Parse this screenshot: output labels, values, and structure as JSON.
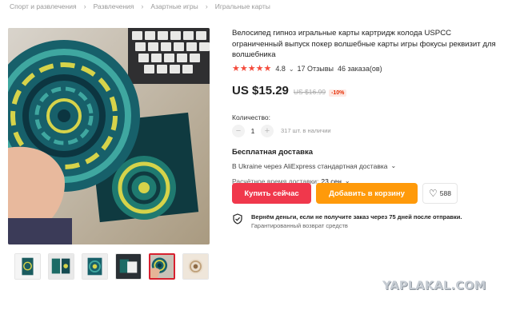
{
  "breadcrumb": [
    "Спорт и развлечения",
    "Развлечения",
    "Азартные игры",
    "Игральные карты"
  ],
  "breadcrumb_separator": "›",
  "product": {
    "title": "Велосипед гипноз игральные карты картридж колода USPCC ограниченный выпуск покер волшебные карты игры фокусы реквизит для волшебника",
    "rating": "4.8",
    "stars": "★★★★★",
    "reviews": "17 Отзывы",
    "orders": "46 заказа(ов)",
    "price": "US $15.29",
    "old_price": "US $16.99",
    "discount": "-10%"
  },
  "quantity": {
    "label": "Количество:",
    "minus": "−",
    "value": "1",
    "plus": "+",
    "stock": "317 шт. в наличии"
  },
  "shipping": {
    "title": "Бесплатная доставка",
    "method": "В Ukraine через AliExpress стандартная доставка",
    "delivery_label": "Расчётное время доставки:",
    "delivery_value": "23 сен"
  },
  "actions": {
    "buy_now": "Купить сейчас",
    "add_to_cart": "Добавить в корзину",
    "wishlist_count": "588"
  },
  "guarantee": {
    "line1": "Вернём деньги, если не получите заказ через 75 дней после отправки.",
    "line2": "Гарантированный возврат средств"
  },
  "icons": {
    "chevron": "⌄",
    "heart": "♡"
  },
  "colors": {
    "buy_button": "#f0384c",
    "cart_button": "#ff9a0a",
    "stars": "#f44b3c",
    "discount": "#e62e04"
  },
  "thumbnails_count": 6,
  "active_thumbnail": 5,
  "watermark": "YAPLAKAL.COM"
}
